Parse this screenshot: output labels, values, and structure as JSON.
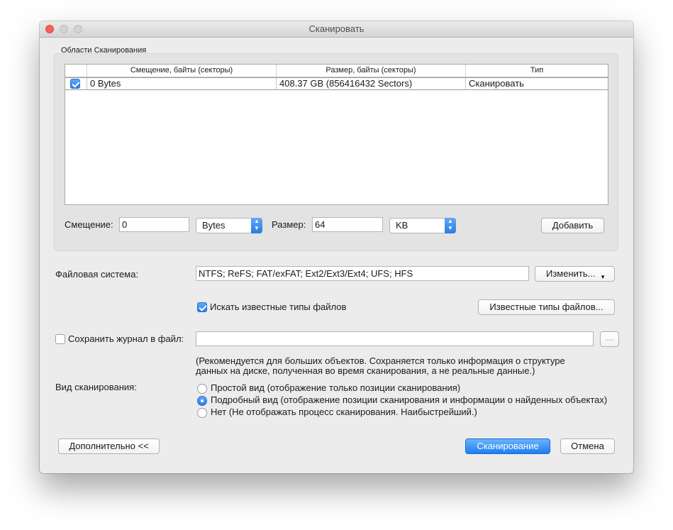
{
  "window": {
    "title": "Сканировать"
  },
  "regions": {
    "group_label": "Области Сканирования",
    "columns": [
      "Смещение, байты (секторы)",
      "Размер, байты (секторы)",
      "Тип"
    ],
    "rows": [
      {
        "checked": true,
        "offset": "0 Bytes",
        "size": "408.37 GB (856416432 Sectors)",
        "type": "Сканировать"
      }
    ],
    "offset_label": "Смещение:",
    "offset_value": "0",
    "offset_unit": "Bytes",
    "size_label": "Размер:",
    "size_value": "64",
    "size_unit": "KB",
    "add_button": "Добавить"
  },
  "filesystem": {
    "label": "Файловая система:",
    "value": "NTFS; ReFS; FAT/exFAT; Ext2/Ext3/Ext4; UFS; HFS",
    "change_button": "Изменить..."
  },
  "known_types": {
    "checkbox_label": "Искать известные типы файлов",
    "checked": true,
    "button": "Известные типы файлов..."
  },
  "log": {
    "checkbox_label": "Сохранить журнал в файл:",
    "checked": false,
    "path_value": "",
    "browse_button": "...",
    "note_line1": "(Рекомендуется для больших объектов. Сохраняется только информация о структуре",
    "note_line2": "данных на диске, полученная во время сканирования, а не реальные данные.)"
  },
  "scan_view": {
    "label": "Вид сканирования:",
    "options": [
      {
        "label": "Простой вид (отображение только позиции сканирования)",
        "selected": false
      },
      {
        "label": "Подробный вид (отображение позиции сканирования и информации о найденных объектах)",
        "selected": true
      },
      {
        "label": "Нет (Не отображать процесс сканирования. Наибыстрейший.)",
        "selected": false
      }
    ]
  },
  "footer": {
    "more_button": "Дополнительно <<",
    "scan_button": "Сканирование",
    "cancel_button": "Отмена"
  },
  "colors": {
    "accent": "#2b7de8",
    "window_bg": "#ececec",
    "close": "#fc5f57"
  }
}
